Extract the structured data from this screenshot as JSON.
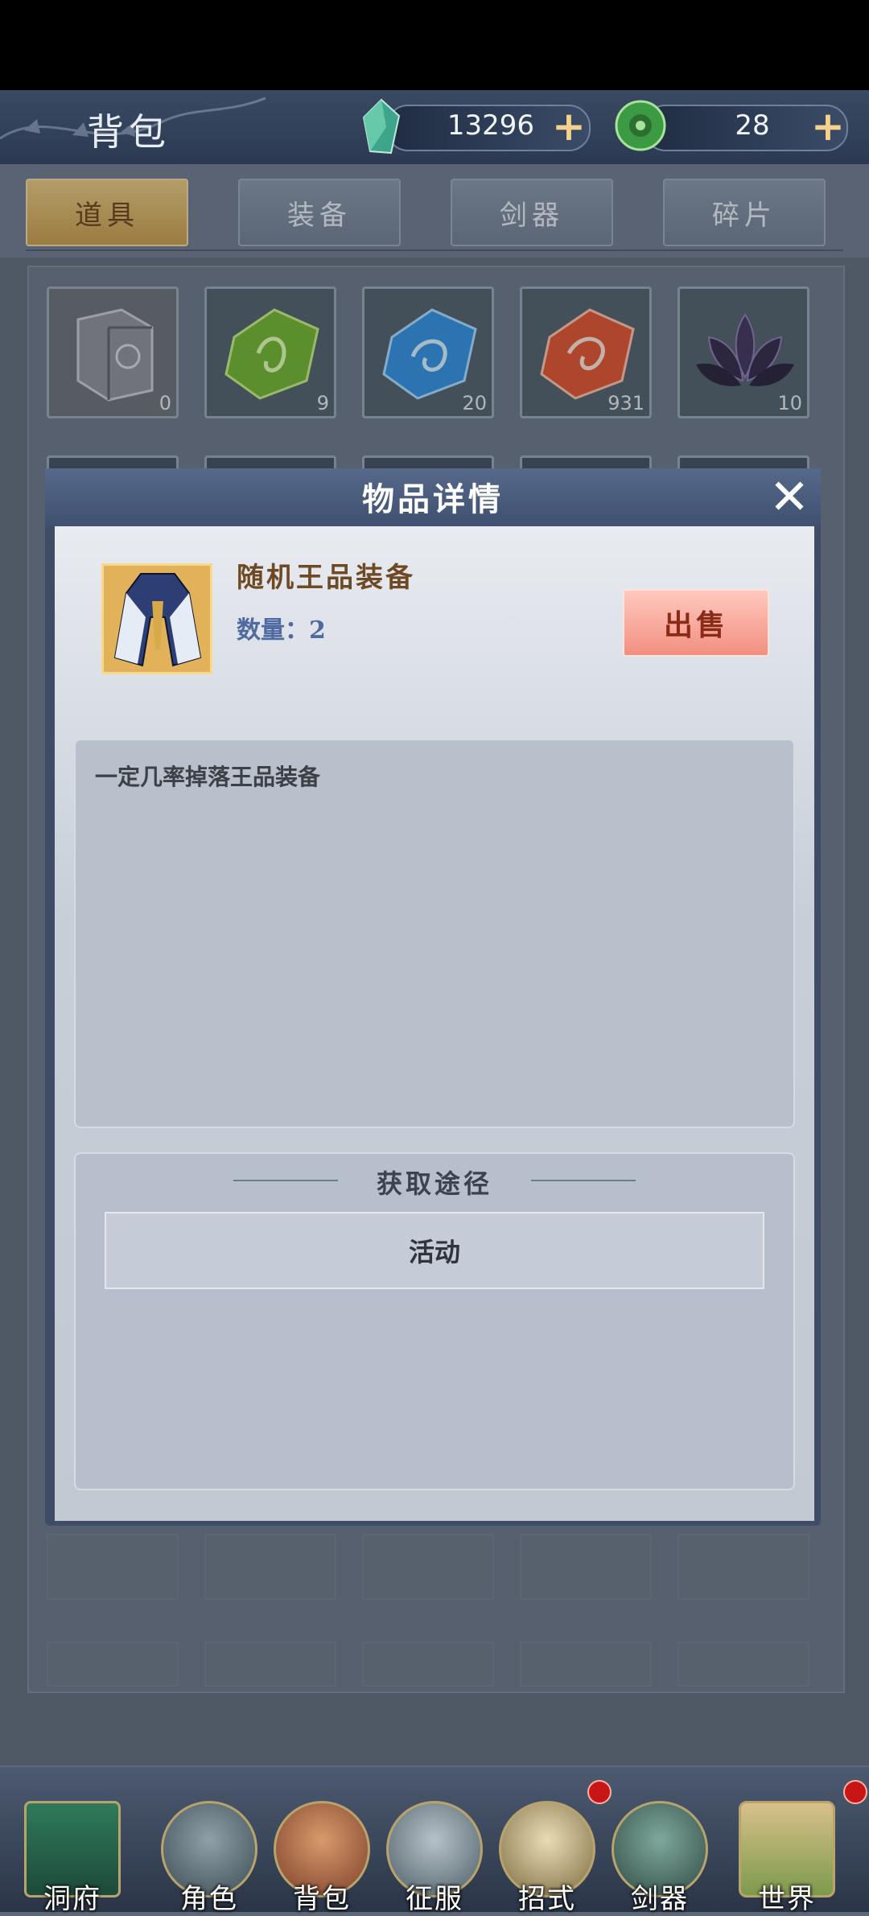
{
  "header": {
    "title": "背包",
    "currencies": [
      {
        "icon": "jade-crystal-icon",
        "value": "13296",
        "plus": "+"
      },
      {
        "icon": "jade-coin-icon",
        "value": "28",
        "plus": "+"
      }
    ]
  },
  "tabs": [
    {
      "label": "道具",
      "active": true
    },
    {
      "label": "装备",
      "active": false
    },
    {
      "label": "剑器",
      "active": false
    },
    {
      "label": "碎片",
      "active": false
    }
  ],
  "inventory": [
    {
      "icon": "book-icon",
      "count": "0",
      "color": "#8a8a8a"
    },
    {
      "icon": "green-gem-icon",
      "count": "9",
      "color": "#6fb42a"
    },
    {
      "icon": "blue-gem-icon",
      "count": "20",
      "color": "#2f8fe0"
    },
    {
      "icon": "red-gem-icon",
      "count": "931",
      "color": "#e2502a"
    },
    {
      "icon": "dark-lotus-icon",
      "count": "10",
      "color": "#3d3055"
    }
  ],
  "modal": {
    "title": "物品详情",
    "item_name": "随机王品装备",
    "quantity_label": "数量：2",
    "sell_label": "出售",
    "description": "一定几率掉落王品装备",
    "source_title": "获取途径",
    "sources": [
      "活动"
    ]
  },
  "nav": [
    {
      "label": "洞府",
      "icon": "cave-mansion-icon",
      "badge": false
    },
    {
      "label": "角色",
      "icon": "character-icon",
      "badge": false
    },
    {
      "label": "背包",
      "icon": "bag-icon",
      "badge": false
    },
    {
      "label": "征服",
      "icon": "crossed-swords-icon",
      "badge": false
    },
    {
      "label": "招式",
      "icon": "scroll-icon",
      "badge": true
    },
    {
      "label": "剑器",
      "icon": "sword-forge-icon",
      "badge": false
    },
    {
      "label": "世界",
      "icon": "world-map-icon",
      "badge": true
    }
  ],
  "colors": {
    "accent_gold": "#e9c77a",
    "sell_red": "#f28f80",
    "badge_red": "#c71616"
  }
}
